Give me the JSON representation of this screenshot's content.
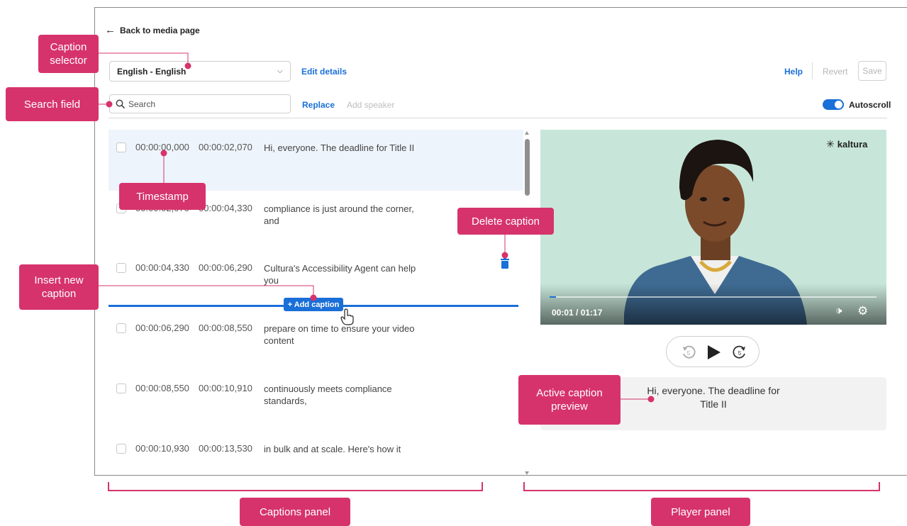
{
  "header": {
    "back_label": "Back to media page",
    "language_value": "English - English",
    "edit_details": "Edit details",
    "help": "Help",
    "revert": "Revert",
    "save": "Save"
  },
  "toolbar": {
    "search_placeholder": "Search",
    "replace": "Replace",
    "add_speaker": "Add speaker",
    "autoscroll_label": "Autoscroll",
    "autoscroll_on": true
  },
  "captions": [
    {
      "start": "00:00:00,000",
      "end": "00:00:02,070",
      "text": "Hi, everyone. The deadline for Title II",
      "active": true
    },
    {
      "start": "00:00:02,070",
      "end": "00:00:04,330",
      "text": "compliance is just around the corner, and",
      "active": false
    },
    {
      "start": "00:00:04,330",
      "end": "00:00:06,290",
      "text": "Cultura's Accessibility Agent can help you",
      "active": false
    },
    {
      "start": "00:00:06,290",
      "end": "00:00:08,550",
      "text": "prepare on time to ensure your video content",
      "active": false
    },
    {
      "start": "00:00:08,550",
      "end": "00:00:10,910",
      "text": "continuously meets compliance standards,",
      "active": false
    },
    {
      "start": "00:00:10,930",
      "end": "00:00:13,530",
      "text": "in bulk and at scale. Here's how it",
      "active": false
    }
  ],
  "add_caption_label": "+ Add caption",
  "player": {
    "brand": "kaltura",
    "time": "00:01 / 01:17",
    "progress_fraction": 0.013,
    "caption_preview": "Hi, everyone. The deadline for Title II"
  },
  "annotations": {
    "caption_selector": "Caption selector",
    "search_field": "Search field",
    "timestamp": "Timestamp",
    "delete_caption": "Delete caption",
    "insert_new_caption": "Insert new caption",
    "active_caption_preview": "Active caption preview",
    "captions_panel": "Captions panel",
    "player_panel": "Player panel"
  },
  "colors": {
    "accent": "#1a6fd8",
    "callout": "#d6336c",
    "active_row": "#eef4fb",
    "video_bg": "#c7e6d9"
  }
}
